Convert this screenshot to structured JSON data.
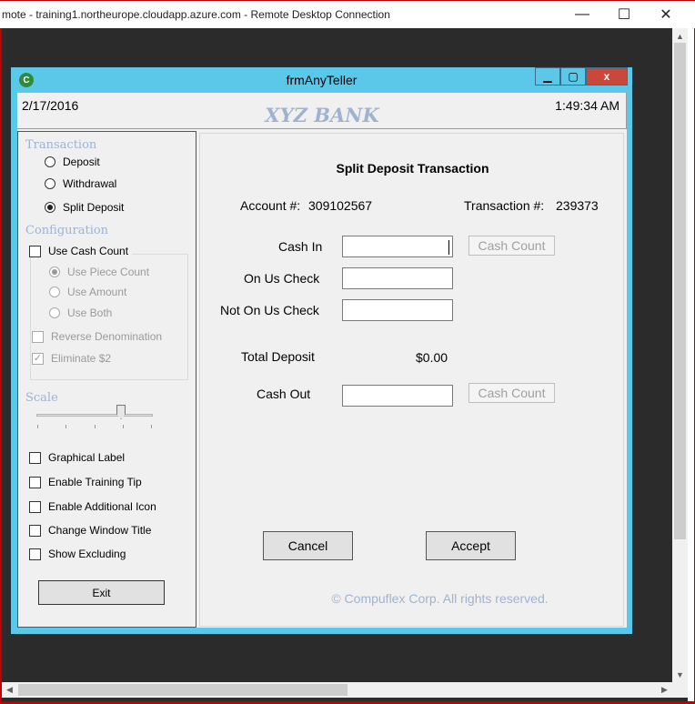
{
  "rdp": {
    "title": "mote - training1.northeurope.cloudapp.azure.com - Remote Desktop Connection",
    "minimize": "—",
    "maximize": "☐",
    "close": "✕"
  },
  "app": {
    "title": "frmAnyTeller",
    "icon_name": "app-logo-icon",
    "min": "▁",
    "max": "▢",
    "close": "x",
    "date": "2/17/2016",
    "time": "1:49:34 AM",
    "bank_name": "XYZ BANK"
  },
  "left": {
    "transaction_title": "Transaction",
    "transaction_options": [
      {
        "label": "Deposit",
        "checked": false
      },
      {
        "label": "Withdrawal",
        "checked": false
      },
      {
        "label": "Split Deposit",
        "checked": true
      }
    ],
    "configuration_title": "Configuration",
    "use_cash_count": "Use Cash Count",
    "use_cash_count_checked": false,
    "count_options": [
      {
        "label": "Use Piece Count",
        "checked": true
      },
      {
        "label": "Use Amount",
        "checked": false
      },
      {
        "label": "Use Both",
        "checked": false
      }
    ],
    "reverse_denomination": "Reverse Denomination",
    "reverse_denomination_checked": false,
    "eliminate_2": "Eliminate $2",
    "eliminate_2_checked": true,
    "scale_title": "Scale",
    "scale_value": 0.75,
    "options": [
      {
        "label": "Graphical Label",
        "checked": false
      },
      {
        "label": "Enable Training Tip",
        "checked": false
      },
      {
        "label": "Enable Additional Icon",
        "checked": false
      },
      {
        "label": "Change Window Title",
        "checked": false
      },
      {
        "label": "Show Excluding",
        "checked": false
      }
    ],
    "exit": "Exit"
  },
  "main": {
    "heading": "Split Deposit Transaction",
    "account_label": "Account #:",
    "account_value": "309102567",
    "transaction_label": "Transaction #:",
    "transaction_value": "239373",
    "cash_in_label": "Cash In",
    "cash_in_value": "",
    "cash_count_label": "Cash Count",
    "on_us_check_label": "On Us Check",
    "on_us_check_value": "",
    "not_on_us_check_label": "Not On Us Check",
    "not_on_us_check_value": "",
    "total_deposit_label": "Total Deposit",
    "total_deposit_value": "$0.00",
    "cash_out_label": "Cash Out",
    "cash_out_value": "",
    "cancel": "Cancel",
    "accept": "Accept",
    "copyright": "© Compuflex Corp. All rights reserved."
  }
}
